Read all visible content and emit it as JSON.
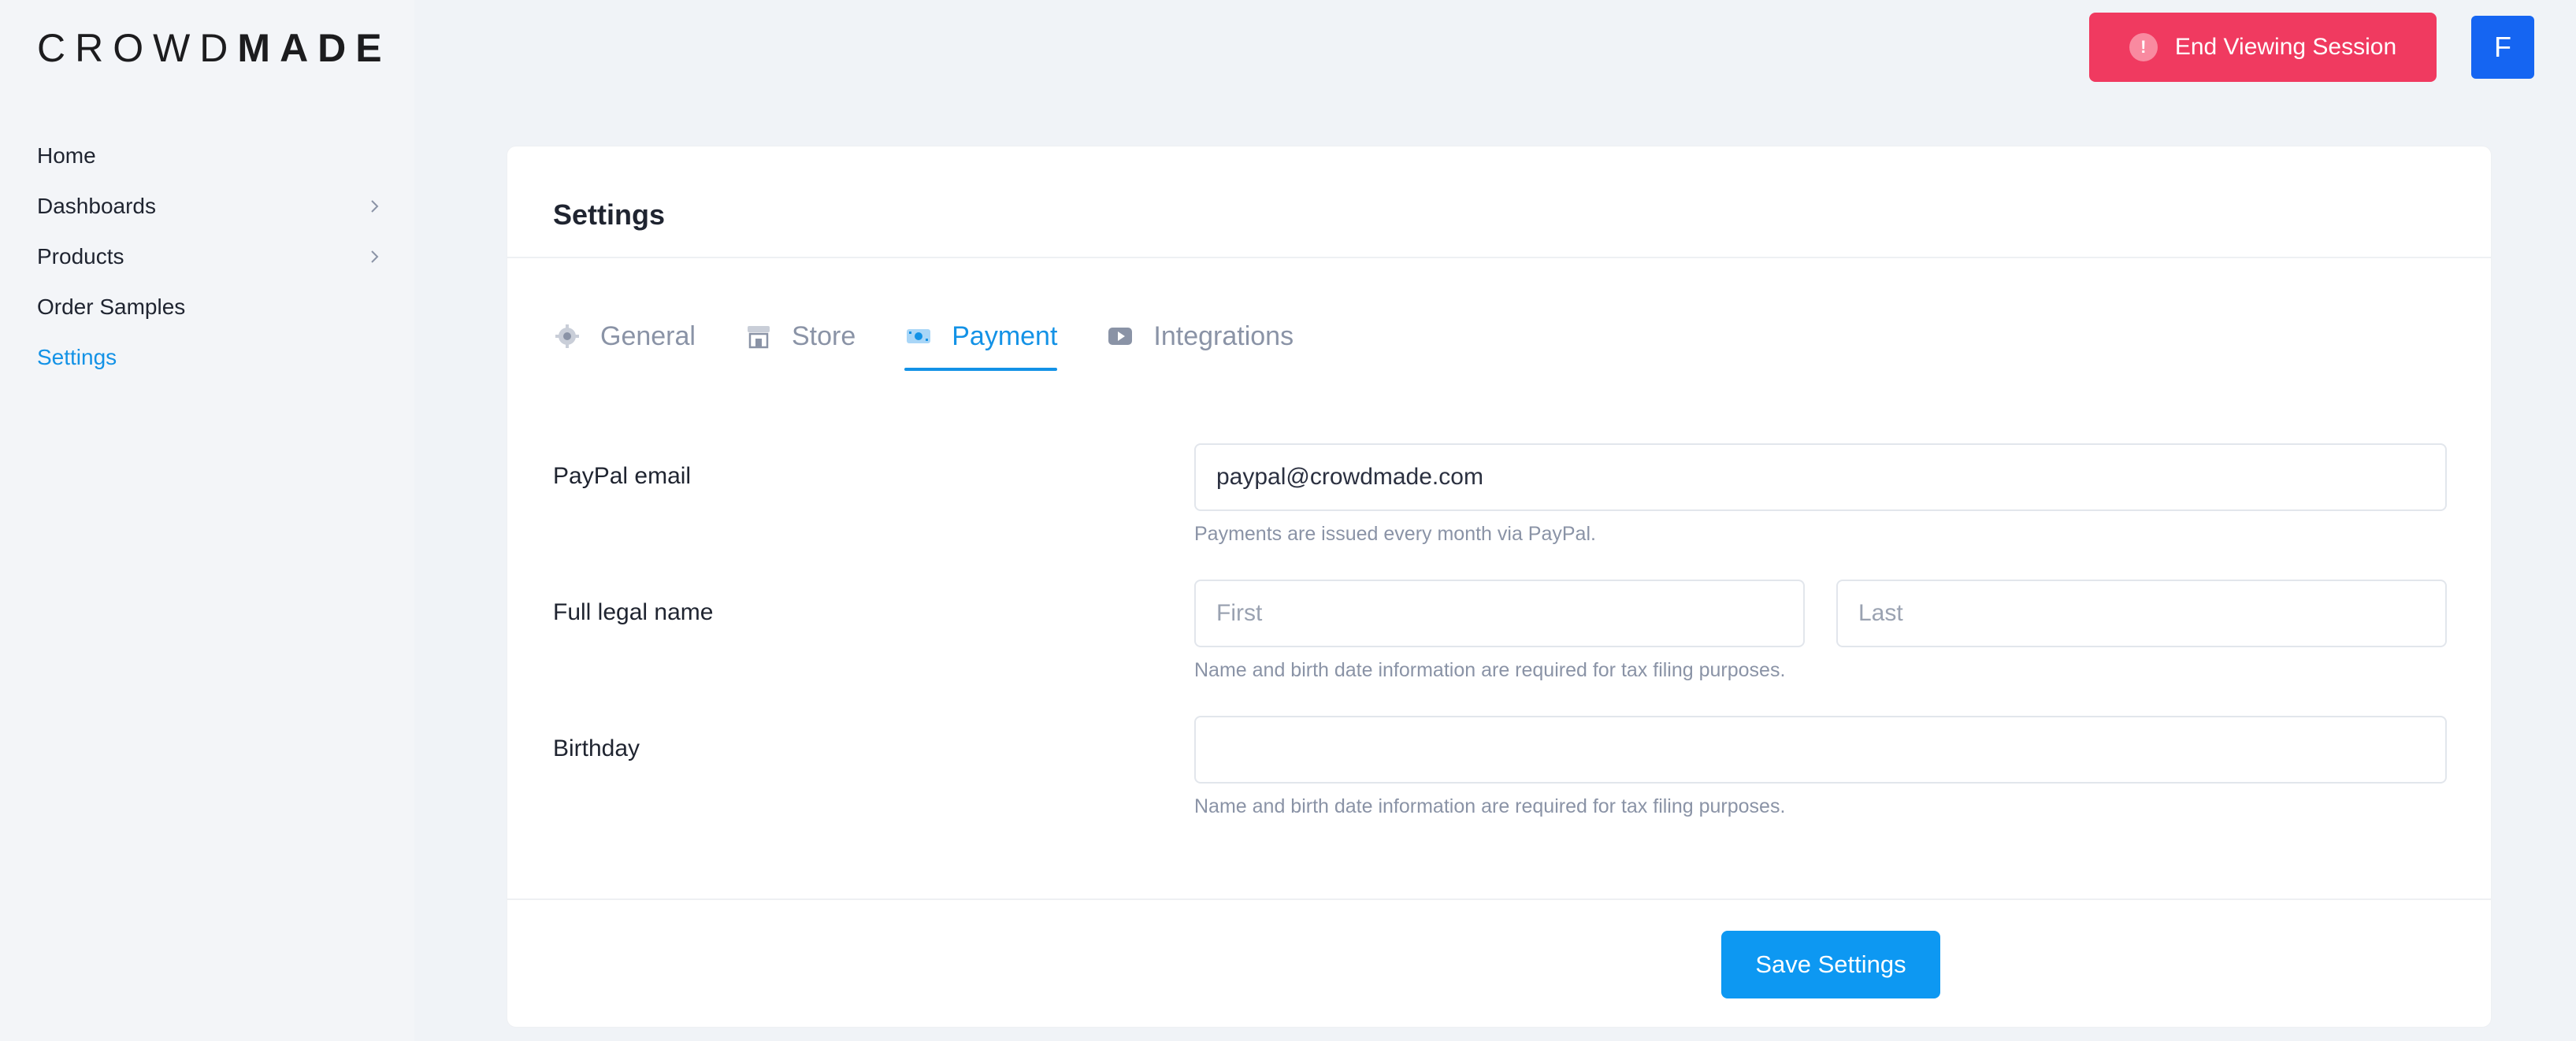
{
  "brand": {
    "light": "CROWD",
    "bold": "MADE"
  },
  "sidebar": {
    "items": [
      {
        "label": "Home"
      },
      {
        "label": "Dashboards"
      },
      {
        "label": "Products"
      },
      {
        "label": "Order Samples"
      },
      {
        "label": "Settings"
      }
    ]
  },
  "header": {
    "end_session_label": "End Viewing Session",
    "alert_glyph": "!",
    "avatar_initial": "F"
  },
  "card": {
    "title": "Settings",
    "tabs": [
      {
        "label": "General",
        "icon": "gear-icon"
      },
      {
        "label": "Store",
        "icon": "store-icon"
      },
      {
        "label": "Payment",
        "icon": "payment-icon"
      },
      {
        "label": "Integrations",
        "icon": "video-icon"
      }
    ],
    "form": {
      "paypal": {
        "label": "PayPal email",
        "value": "paypal@crowdmade.com",
        "help": "Payments are issued every month via PayPal."
      },
      "legal_name": {
        "label": "Full legal name",
        "first_placeholder": "First",
        "last_placeholder": "Last",
        "help": "Name and birth date information are required for tax filing purposes."
      },
      "birthday": {
        "label": "Birthday",
        "value": "",
        "help": "Name and birth date information are required for tax filing purposes."
      }
    },
    "save_label": "Save Settings"
  },
  "colors": {
    "accent": "#1392e6",
    "danger": "#f03a60",
    "avatar": "#1565f2"
  }
}
